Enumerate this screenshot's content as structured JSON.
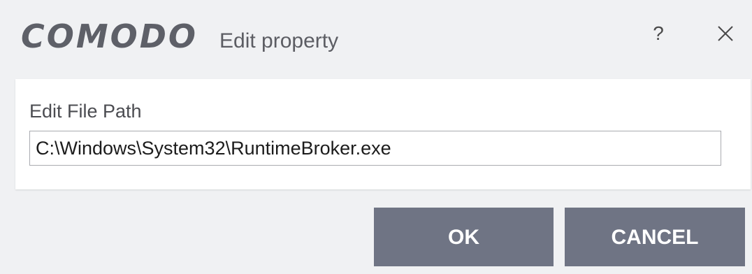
{
  "window": {
    "brand": "COMODO",
    "title": "Edit property",
    "help_label": "?",
    "close_icon": "close-icon"
  },
  "form": {
    "label": "Edit File Path",
    "path_value": "C:\\Windows\\System32\\RuntimeBroker.exe"
  },
  "buttons": {
    "ok_label": "OK",
    "cancel_label": "CANCEL"
  },
  "colors": {
    "background": "#f0f1f3",
    "brand_text": "#5e6068",
    "button_bg": "#6f7484",
    "button_text": "#ffffff",
    "panel_bg": "#ffffff"
  }
}
